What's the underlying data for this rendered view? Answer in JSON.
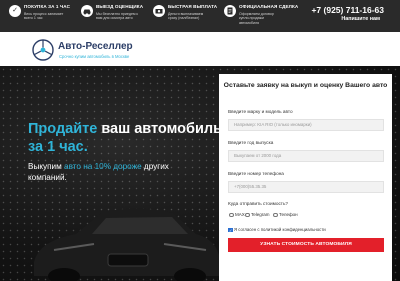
{
  "topbar": {
    "features": [
      {
        "icon": "shield-check-icon",
        "title": "ПОКУПКА ЗА 1 ЧАС",
        "desc": "Весь процесс занимает всего 1 час"
      },
      {
        "icon": "car-icon",
        "title": "ВЫЕЗД ОЦЕНЩИКА",
        "desc": "Мы бесплатно приедем к вам для осмотра авто"
      },
      {
        "icon": "money-icon",
        "title": "БЫСТРАЯ ВЫПЛАТА",
        "desc": "Деньги выплачиваем сразу (нал/безнал)"
      },
      {
        "icon": "document-icon",
        "title": "ОФИЦИАЛЬНАЯ СДЕЛКА",
        "desc": "Оформляем договор купли-продажи автомобиля"
      }
    ],
    "phone": "+7 (925) 711-16-63",
    "call_label": "Напишите нам"
  },
  "header": {
    "logo_name": "Авто-Реселлер",
    "logo_sub": "Срочно купим автомобиль в Москве"
  },
  "hero": {
    "headline_1": "Продайте",
    "headline_2": " ваш автомобиль ",
    "headline_3": "за 1 час.",
    "sub_1": "Выкупим ",
    "sub_2": "авто на 10% дороже",
    "sub_3": " других компаний."
  },
  "form": {
    "title": "Оставьте заявку на выкуп и оценку Вашего авто",
    "brand_label": "Введите марку и модель авто",
    "brand_placeholder": "Например: KIA RIO (только иномарки)",
    "year_label": "Введите год выпуска",
    "year_placeholder": "Выкупаем от 2000 года",
    "phone_label": "Введите номер телефона",
    "phone_placeholder": "+7(000)55.35.35",
    "send_label": "Куда отправить стоимость?",
    "options": [
      "MAX",
      "Telegram",
      "Телефон"
    ],
    "agree_label": "Я согласен с политикой конфиденциальности",
    "submit_label": "УЗНАТЬ СТОИМОСТЬ АВТОМОБИЛЯ"
  }
}
